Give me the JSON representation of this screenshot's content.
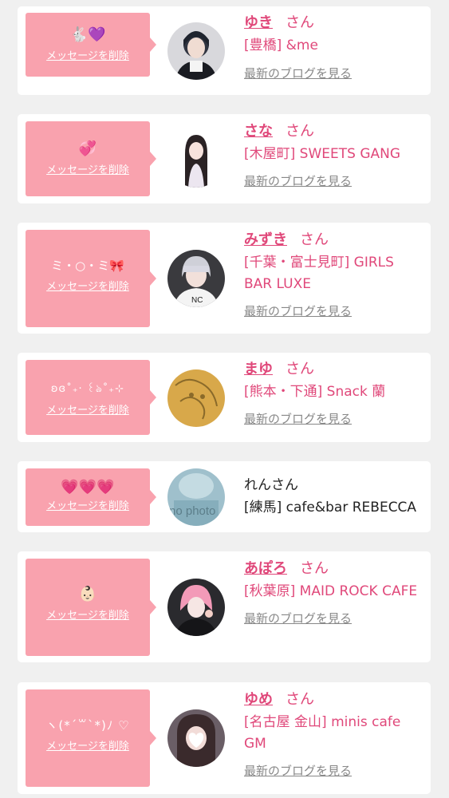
{
  "delete_label": "メッセージを削除",
  "blog_label": "最新のブログを見る",
  "colors": {
    "accent": "#e0487a",
    "bubble": "#f9a2ae",
    "card": "#ffffff",
    "page": "#f0f0f0"
  },
  "items": [
    {
      "stamp": "🐇💜",
      "name": "ゆき",
      "san": "さん",
      "shop": "[豊橋] &me",
      "avatar": "photo-girl-black-top"
    },
    {
      "stamp": "💞",
      "name": "さな",
      "san": "さん",
      "shop": "[木屋町] SWEETS GANG",
      "avatar": "photo-girl-long-hair"
    },
    {
      "stamp": "ミ・○・ミ🎀",
      "name": "みずき",
      "san": "さん",
      "shop": "[千葉・富士見町] GIRLS BAR LUXE",
      "avatar": "photo-girl-bangs"
    },
    {
      "stamp": "ʚɞ˚₊‧ ꒰ঌ˚₊⊹",
      "name": "まゆ",
      "san": "さん",
      "shop": "[熊本・下通] Snack 蘭",
      "avatar": "illustration-gold"
    },
    {
      "stamp": "💗💗💗",
      "name": "れんさん",
      "shop": "[練馬] cafe&bar REBECCA",
      "avatar": "no photo"
    },
    {
      "stamp": "👶🏻",
      "name": "あぽろ",
      "san": "さん",
      "shop": "[秋葉原] MAID ROCK CAFE",
      "avatar": "photo-girl-pink-hair"
    },
    {
      "stamp": "ヽ(*´꒳`*)ﾉ ♡",
      "name": "ゆめ",
      "san": "さん",
      "shop": "[名古屋 金山] minis cafe GM",
      "avatar": "photo-girl-heart-face"
    }
  ]
}
